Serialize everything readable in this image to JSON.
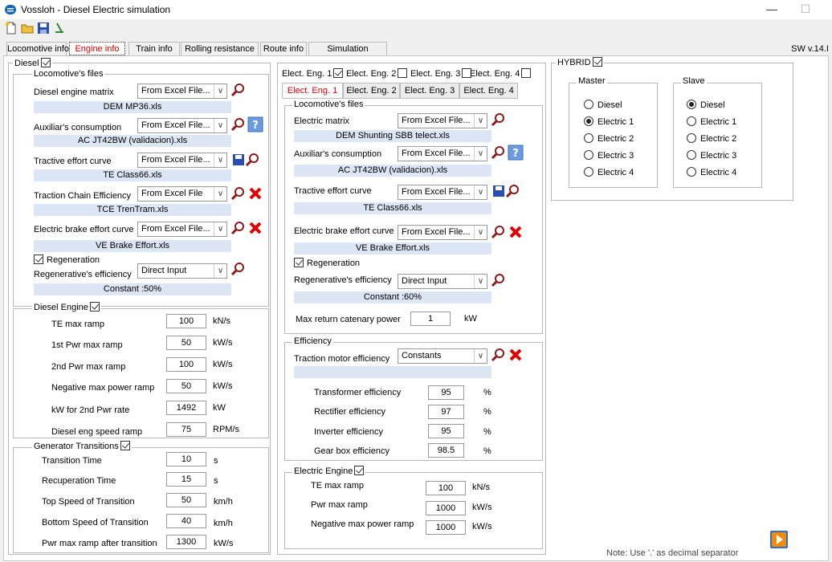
{
  "window": {
    "title": "Vossloh - Diesel Electric simulation",
    "minimize": "—",
    "maximize": "☐"
  },
  "tabs": [
    "Locomotive info",
    "Engine info",
    "Train info",
    "Rolling resistance",
    "Route info",
    "Simulation"
  ],
  "sw_version": "SW v.14.I",
  "diesel": {
    "legend": "Diesel",
    "files_legend": "Locomotive's files",
    "rows": [
      {
        "label": "Diesel engine matrix",
        "combo": "From Excel File...",
        "file": "DEM MP36.xls"
      },
      {
        "label": "Auxiliar's consumption",
        "combo": "From Excel File...",
        "file": "AC JT42BW (validacion).xls"
      },
      {
        "label": "Tractive effort curve",
        "combo": "From Excel File...",
        "file": "TE Class66.xls"
      },
      {
        "label": "Traction Chain Efficiency",
        "combo": "From Excel File",
        "file": "TCE TrenTram.xls"
      },
      {
        "label": "Electric brake effort curve",
        "combo": "From Excel File...",
        "file": "VE Brake Effort.xls"
      }
    ],
    "regeneration": "Regeneration",
    "regen_label": "Regenerative's  efficiency",
    "regen_combo": "Direct Input",
    "regen_value": "Constant :50%",
    "engine_legend": "Diesel Engine",
    "engine": [
      {
        "label": "TE max ramp",
        "value": "100",
        "unit": "kN/s"
      },
      {
        "label": "1st Pwr max ramp",
        "value": "50",
        "unit": "kW/s"
      },
      {
        "label": "2nd Pwr max ramp",
        "value": "100",
        "unit": "kW/s"
      },
      {
        "label": "Negative max power ramp",
        "value": "50",
        "unit": "kW/s"
      },
      {
        "label": "kW for 2nd Pwr rate",
        "value": "1492",
        "unit": "kW"
      },
      {
        "label": "Diesel eng speed ramp",
        "value": "75",
        "unit": "RPM/s"
      }
    ],
    "gen_legend": "Generator Transitions",
    "gen": [
      {
        "label": "Transition Time",
        "value": "10",
        "unit": "s"
      },
      {
        "label": "Recuperation Time",
        "value": "15",
        "unit": "s"
      },
      {
        "label": "Top Speed of Transition",
        "value": "50",
        "unit": "km/h"
      },
      {
        "label": "Bottom Speed of Transition",
        "value": "40",
        "unit": "km/h"
      },
      {
        "label": "Pwr max ramp after transition",
        "value": "1300",
        "unit": "kW/s"
      }
    ]
  },
  "electric": {
    "engine_checks": [
      "Elect. Eng. 1",
      "Elect. Eng. 2",
      "Elect. Eng. 3",
      "Elect. Eng. 4"
    ],
    "subtabs": [
      "Elect. Eng. 1",
      "Elect. Eng. 2",
      "Elect. Eng. 3",
      "Elect. Eng. 4"
    ],
    "files_legend": "Locomotive's files",
    "rows": [
      {
        "label": "Electric  matrix",
        "combo": "From Excel File...",
        "file": "DEM Shunting SBB telect.xls"
      },
      {
        "label": "Auxiliar's consumption",
        "combo": "From Excel File...",
        "file": "AC JT42BW (validacion).xls"
      },
      {
        "label": "Tractive effort curve",
        "combo": "From Excel File...",
        "file": "TE Class66.xls"
      },
      {
        "label": "Electric brake effort curve",
        "combo": "From Excel File...",
        "file": "VE Brake Effort.xls"
      }
    ],
    "regeneration": "Regeneration",
    "regen_label": "Regenerative's  efficiency",
    "regen_combo": "Direct Input",
    "regen_value": "Constant :60%",
    "catenary_label": "Max return catenary power",
    "catenary_value": "1",
    "catenary_unit": "kW",
    "eff_legend": "Efficiency",
    "traction_label": "Traction motor efficiency",
    "traction_combo": "Constants",
    "effs": [
      {
        "label": "Transformer efficiency",
        "value": "95",
        "unit": "%"
      },
      {
        "label": "Rectifier efficiency",
        "value": "97",
        "unit": "%"
      },
      {
        "label": "Inverter efficiency",
        "value": "95",
        "unit": "%"
      },
      {
        "label": "Gear box efficiency",
        "value": "98.5",
        "unit": "%"
      }
    ],
    "eng_legend": "Electric Engine",
    "eng": [
      {
        "label": "TE max ramp",
        "value": "100",
        "unit": "kN/s"
      },
      {
        "label": "Pwr max ramp",
        "value": "1000",
        "unit": "kW/s"
      },
      {
        "label": "Negative max power ramp",
        "value": "1000",
        "unit": "kW/s"
      }
    ]
  },
  "hybrid": {
    "legend": "HYBRID",
    "master_legend": "Master",
    "slave_legend": "Slave",
    "options": [
      "Diesel",
      "Electric 1",
      "Electric 2",
      "Electric 3",
      "Electric 4"
    ],
    "master_selected": "Electric 1",
    "slave_selected": "Diesel"
  },
  "note": "Note: Use '.' as decimal separator"
}
